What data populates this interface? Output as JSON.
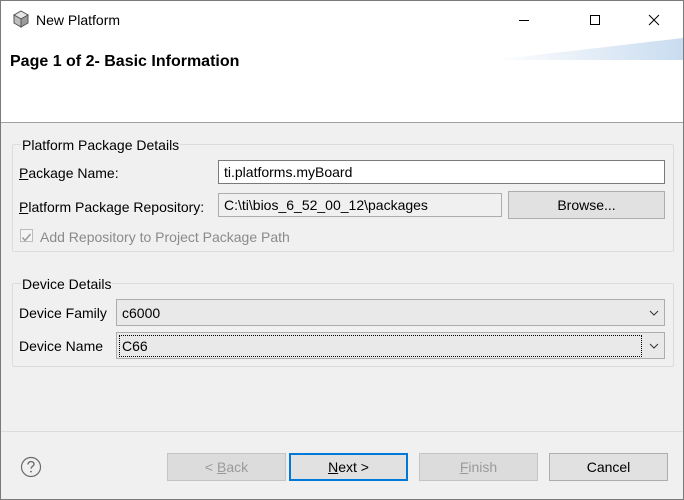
{
  "window": {
    "title": "New Platform",
    "icon": "package-icon"
  },
  "header": {
    "page_title": "Page 1 of 2- Basic Information"
  },
  "platform_group": {
    "title": "Platform Package Details",
    "package_name_label_u": "P",
    "package_name_label_rest": "ackage Name:",
    "package_name_value": "ti.platforms.myBoard",
    "repository_label_u": "P",
    "repository_label_rest": "latform Package Repository:",
    "repository_value": "C:\\ti\\bios_6_52_00_12\\packages",
    "browse_label": "Browse...",
    "add_repo_label": "Add Repository to Project Package Path",
    "add_repo_checked": true
  },
  "device_group": {
    "title": "Device Details",
    "family_label": "Device Family",
    "family_value": "c6000",
    "name_label": "Device Name",
    "name_value": "C66"
  },
  "footer": {
    "back_lt": "< ",
    "back_u": "B",
    "back_rest": "ack",
    "next_u": "N",
    "next_rest": "ext >",
    "finish_u": "F",
    "finish_rest": "inish",
    "cancel_label": "Cancel"
  },
  "colors": {
    "accent": "#0078d7",
    "window_bg": "#f0f0f0",
    "disabled_text": "#9a9a9a"
  }
}
